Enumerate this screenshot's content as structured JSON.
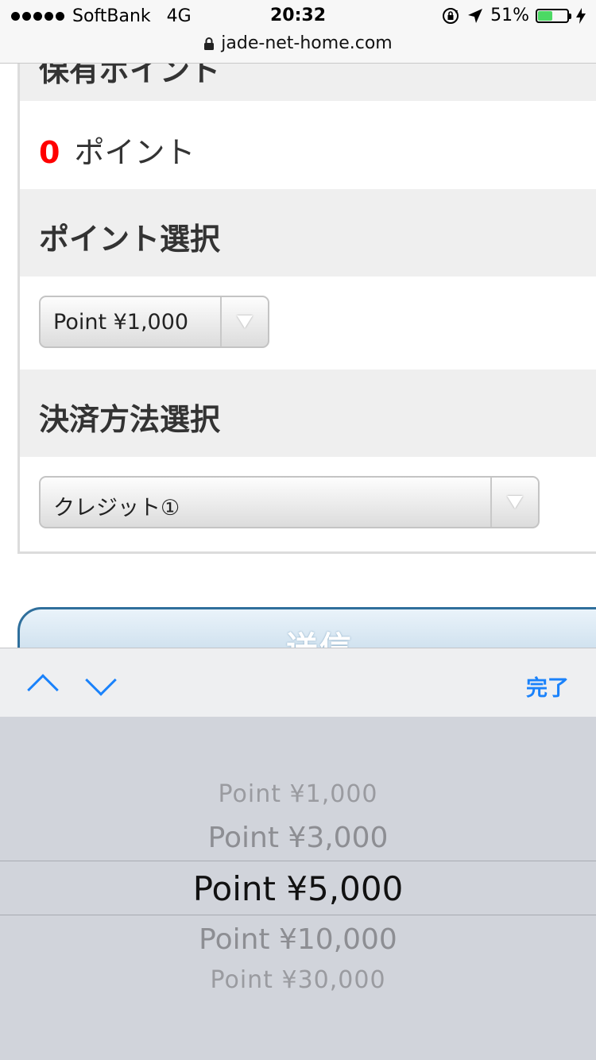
{
  "status_bar": {
    "carrier": "SoftBank",
    "network": "4G",
    "time": "20:32",
    "battery": "51%",
    "battery_level": 0.51
  },
  "url_bar": {
    "url": "jade-net-home.com"
  },
  "points_section": {
    "title": "保有ポイント",
    "value": "0",
    "unit": "ポイント"
  },
  "point_select_section": {
    "title": "ポイント選択",
    "selected": "Point ¥1,000"
  },
  "payment_section": {
    "title": "決済方法選択",
    "selected": "クレジット①"
  },
  "submit": {
    "label": "送信"
  },
  "accessory": {
    "done_label": "完了"
  },
  "picker": {
    "options": [
      "Point ¥1,000",
      "Point ¥3,000",
      "Point ¥5,000",
      "Point ¥10,000",
      "Point ¥30,000"
    ],
    "selected": "Point ¥5,000"
  },
  "colors": {
    "accent": "#1a82fb",
    "points_value": "#ff0000",
    "battery": "#4cd964"
  }
}
